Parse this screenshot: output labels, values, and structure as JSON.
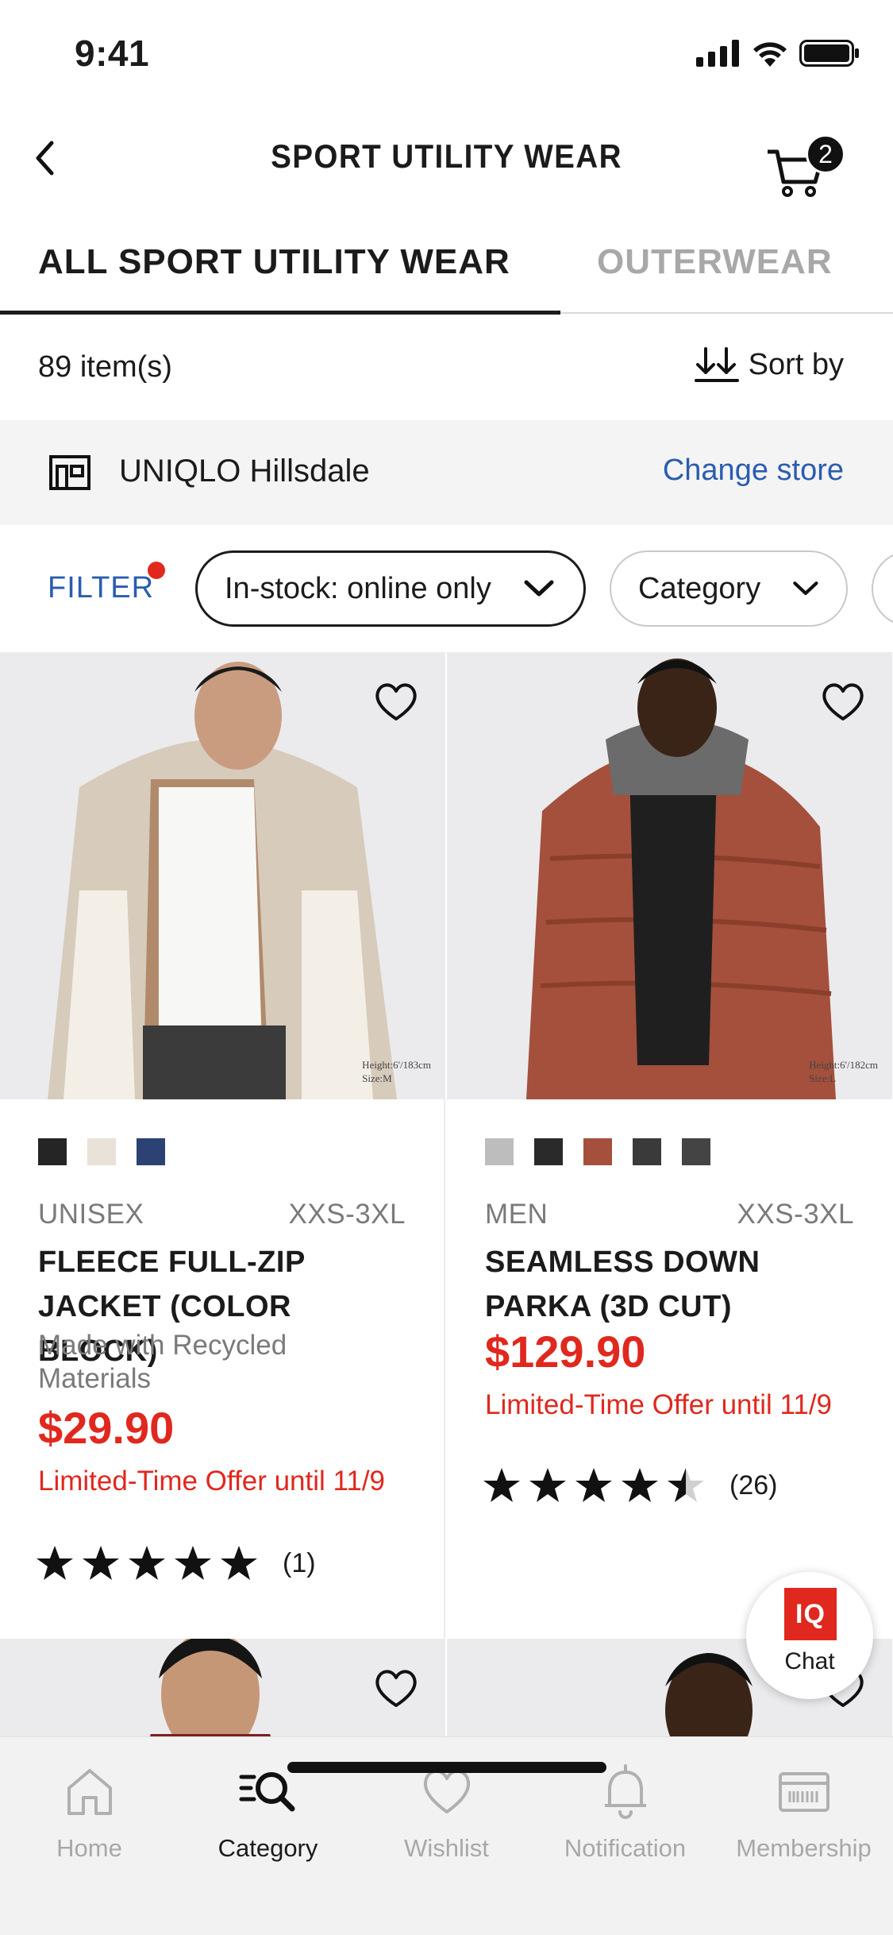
{
  "status": {
    "time": "9:41"
  },
  "header": {
    "title": "SPORT UTILITY WEAR",
    "cart_count": "2"
  },
  "tabs": [
    {
      "label": "ALL SPORT UTILITY WEAR",
      "active": true
    },
    {
      "label": "OUTERWEAR",
      "active": false
    }
  ],
  "listing": {
    "count": "89 item(s)",
    "sort_label": "Sort by"
  },
  "store": {
    "name": "UNIQLO Hillsdale",
    "change_label": "Change store"
  },
  "filters": {
    "filter_label": "FILTER",
    "chips": [
      "In-stock: online only",
      "Category"
    ]
  },
  "products": [
    {
      "gender": "UNISEX",
      "size": "XXS-3XL",
      "name": "FLEECE FULL-ZIP JACKET (COLOR BLOCK)",
      "note": "Made with Recycled Materials",
      "price": "$29.90",
      "offer": "Limited-Time Offer until 11/9",
      "rating": 5,
      "review_count": "(1)",
      "model_height": "Height:6'/183cm",
      "model_size": "Size:M",
      "swatches": [
        "#252525",
        "#e8e2d8",
        "#2b4273"
      ]
    },
    {
      "gender": "MEN",
      "size": "XXS-3XL",
      "name": "SEAMLESS DOWN PARKA (3D CUT)",
      "price": "$129.90",
      "offer": "Limited-Time Offer until 11/9",
      "rating": 4.5,
      "review_count": "(26)",
      "model_height": "Height:6'/182cm",
      "model_size": "Size:L",
      "swatches": [
        "#bdbdbd",
        "#2a2a2a",
        "#a4503c",
        "#3a3a3a",
        "#444444"
      ]
    }
  ],
  "chat": {
    "logo": "IQ",
    "label": "Chat"
  },
  "bottom_nav": [
    {
      "label": "Home",
      "icon": "home-icon",
      "active": false
    },
    {
      "label": "Category",
      "icon": "category-search-icon",
      "active": true
    },
    {
      "label": "Wishlist",
      "icon": "heart-icon",
      "active": false
    },
    {
      "label": "Notification",
      "icon": "bell-icon",
      "active": false
    },
    {
      "label": "Membership",
      "icon": "membership-card-icon",
      "active": false
    }
  ],
  "colors": {
    "accent_red": "#e0281e",
    "link_blue": "#2a5db0",
    "text": "#1b1b1b",
    "muted": "#7a7a7a"
  }
}
